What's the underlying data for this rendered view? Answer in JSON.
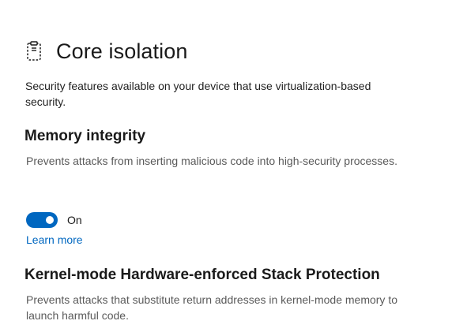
{
  "header": {
    "icon": "core-isolation-chip-icon",
    "title": "Core isolation"
  },
  "intro": {
    "text": "Security features available on your device that use virtualization-based security."
  },
  "memory_integrity": {
    "heading": "Memory integrity",
    "description": "Prevents attacks from inserting malicious code into high-security processes.",
    "toggle_state": "On",
    "toggle_on": true,
    "learn_more_label": "Learn more"
  },
  "kernel_stack_protection": {
    "heading": "Kernel-mode Hardware-enforced Stack Protection",
    "description": "Prevents attacks that substitute return addresses in kernel-mode memory to launch harmful code."
  },
  "colors": {
    "accent": "#0067c0",
    "text_primary": "#1a1a1a",
    "text_secondary": "#5a5a5a"
  }
}
